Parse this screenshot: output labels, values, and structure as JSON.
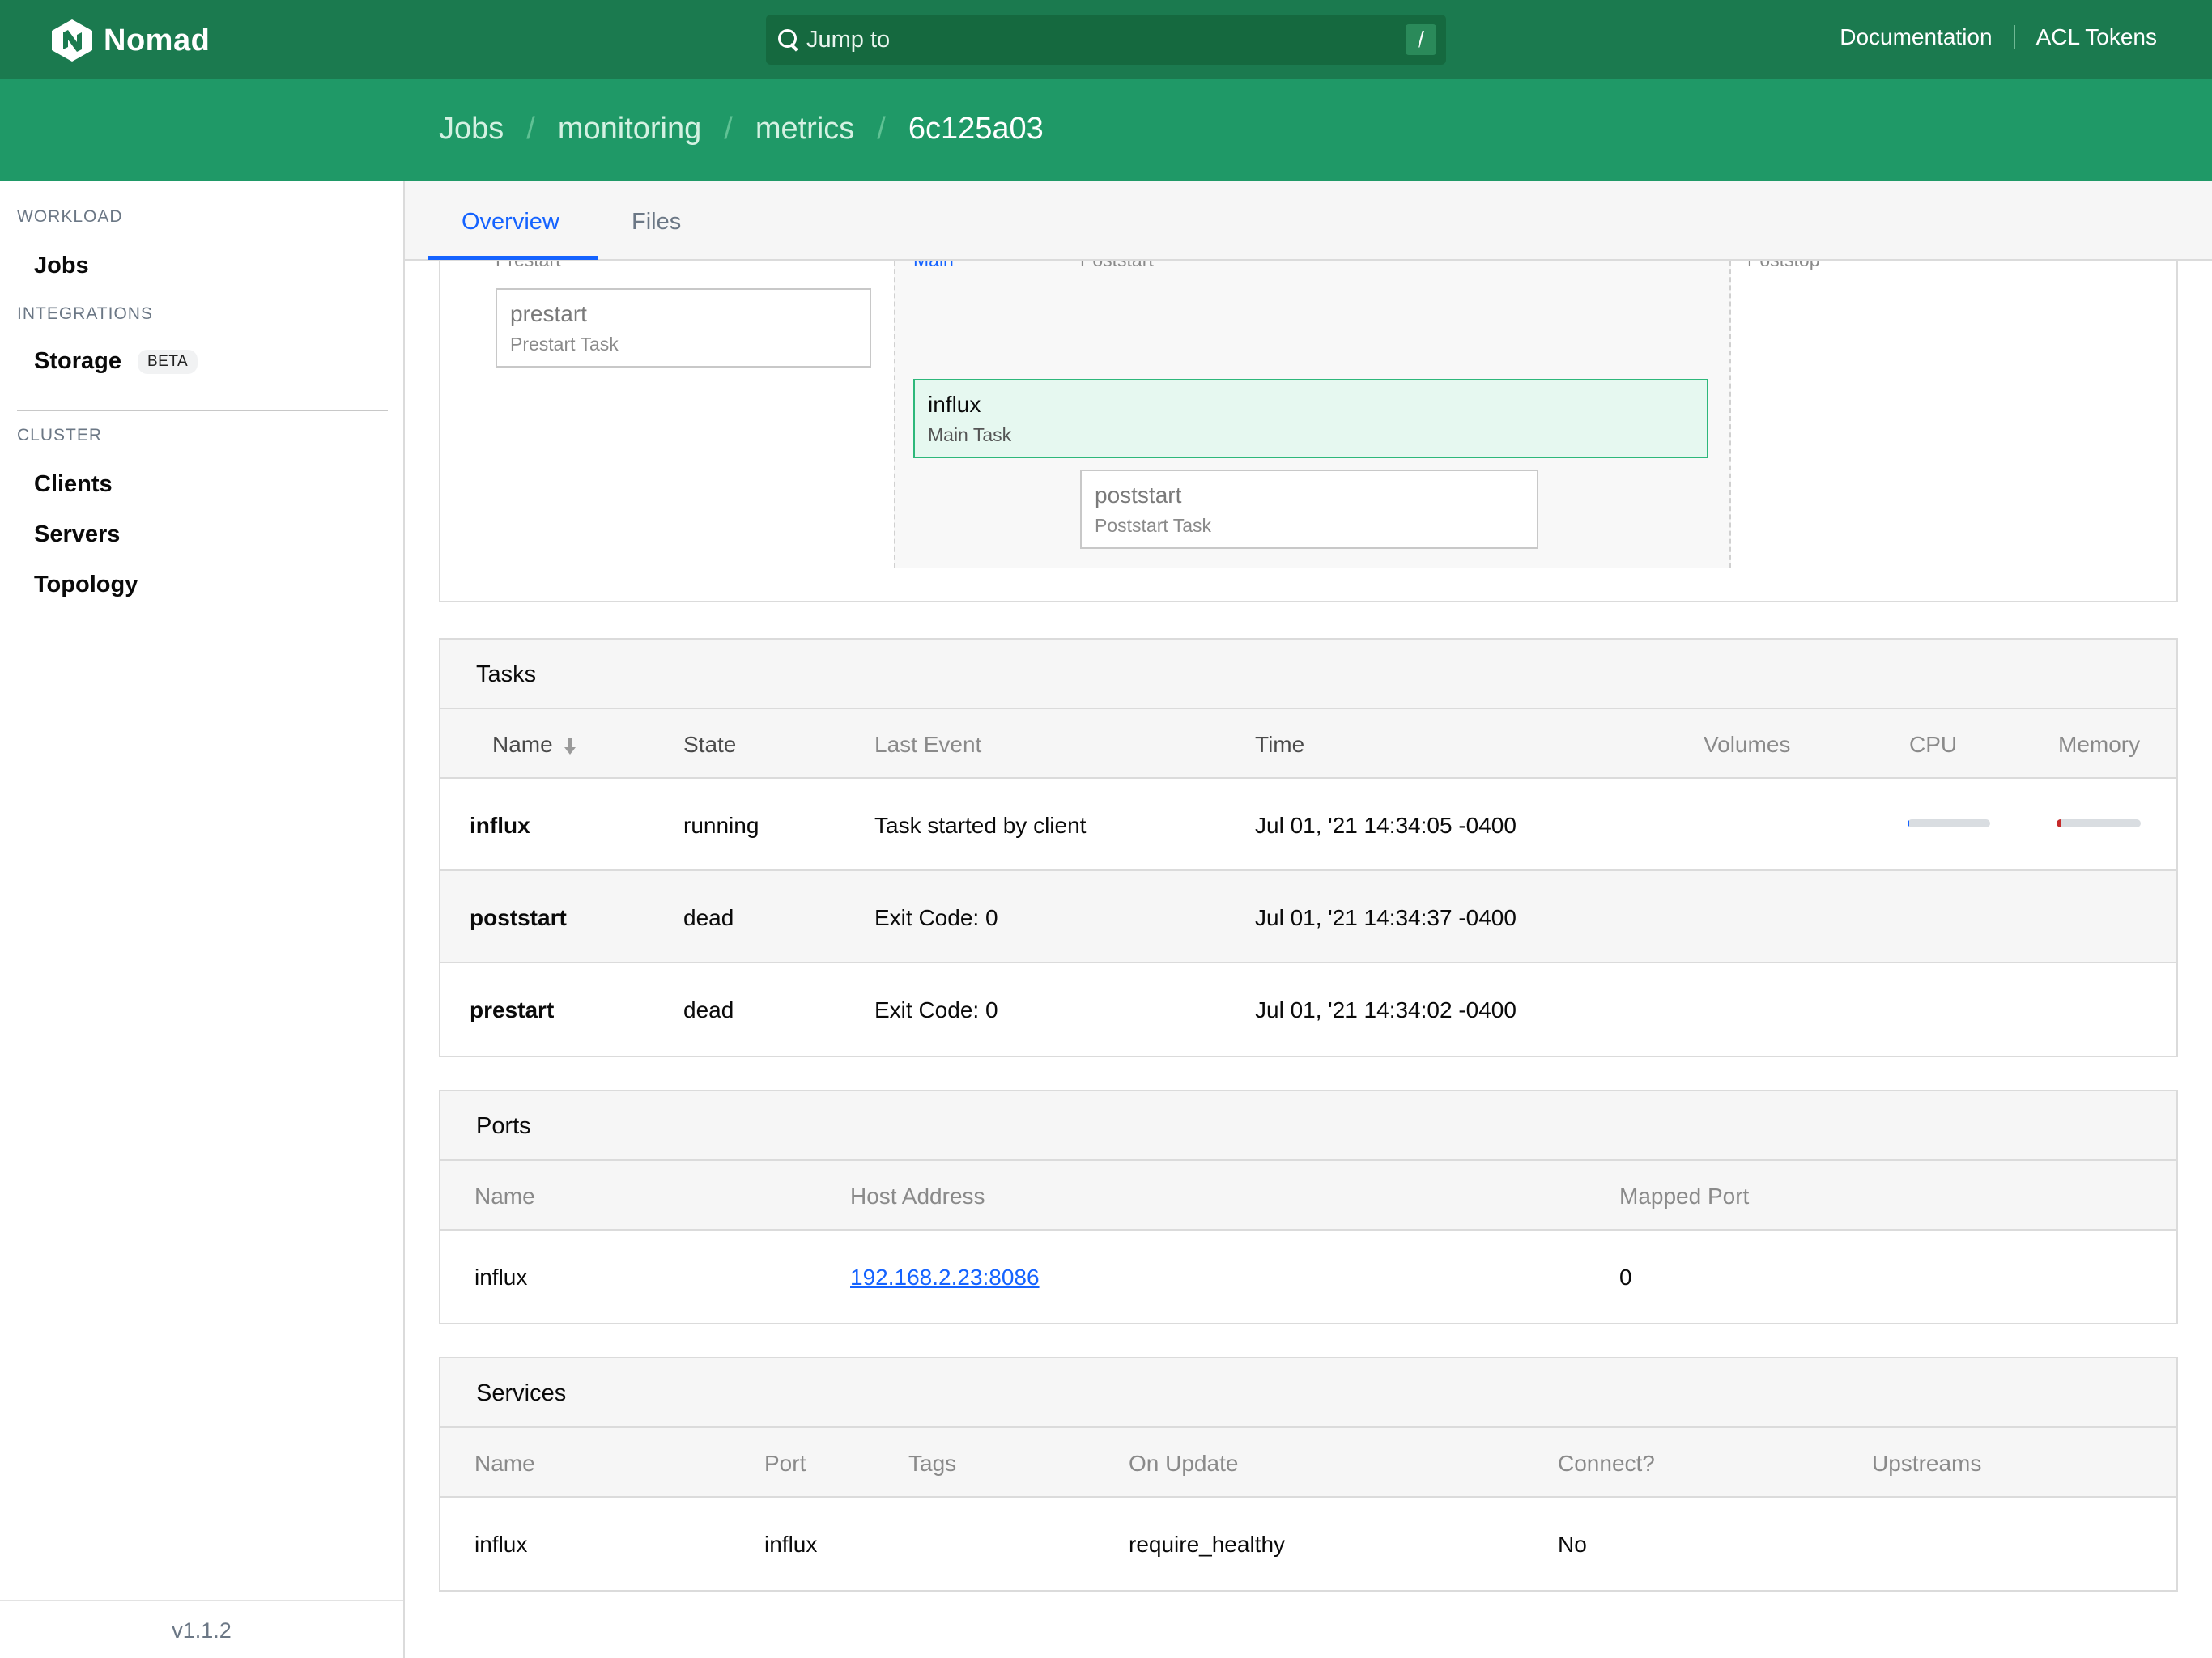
{
  "navbar": {
    "brand": "Nomad",
    "search_placeholder": "Jump to",
    "search_shortcut": "/",
    "links": [
      "Documentation",
      "ACL Tokens"
    ]
  },
  "breadcrumb": [
    "Jobs",
    "monitoring",
    "metrics",
    "6c125a03"
  ],
  "sidebar": {
    "workload_label": "WORKLOAD",
    "jobs": "Jobs",
    "integrations_label": "INTEGRATIONS",
    "storage": "Storage",
    "storage_badge": "BETA",
    "cluster_label": "CLUSTER",
    "clients": "Clients",
    "servers": "Servers",
    "topology": "Topology",
    "version": "v1.1.2"
  },
  "tabs": [
    "Overview",
    "Files"
  ],
  "lifecycle": {
    "phases": [
      "Prestart",
      "Main",
      "Poststart",
      "Poststop"
    ],
    "tasks": [
      {
        "name": "prestart",
        "kind": "Prestart Task"
      },
      {
        "name": "influx",
        "kind": "Main Task"
      },
      {
        "name": "poststart",
        "kind": "Poststart Task"
      }
    ]
  },
  "tasks_table": {
    "title": "Tasks",
    "headers": [
      "Name",
      "State",
      "Last Event",
      "Time",
      "Volumes",
      "CPU",
      "Memory"
    ],
    "rows": [
      {
        "name": "influx",
        "state": "running",
        "event": "Task started by client",
        "time": "Jul 01, '21 14:34:05 -0400",
        "cpu_fraction": 0.02,
        "memory_fraction": 0.05
      },
      {
        "name": "poststart",
        "state": "dead",
        "event": "Exit Code: 0",
        "time": "Jul 01, '21 14:34:37 -0400"
      },
      {
        "name": "prestart",
        "state": "dead",
        "event": "Exit Code: 0",
        "time": "Jul 01, '21 14:34:02 -0400"
      }
    ],
    "colors": {
      "cpu": "#1563ff",
      "memory": "#c62a2a"
    }
  },
  "ports_table": {
    "title": "Ports",
    "headers": [
      "Name",
      "Host Address",
      "Mapped Port"
    ],
    "rows": [
      {
        "name": "influx",
        "address": "192.168.2.23:8086",
        "mapped": "0"
      }
    ]
  },
  "services_table": {
    "title": "Services",
    "headers": [
      "Name",
      "Port",
      "Tags",
      "On Update",
      "Connect?",
      "Upstreams"
    ],
    "rows": [
      {
        "name": "influx",
        "port": "influx",
        "tags": "",
        "on_update": "require_healthy",
        "connect": "No",
        "upstreams": ""
      }
    ]
  }
}
